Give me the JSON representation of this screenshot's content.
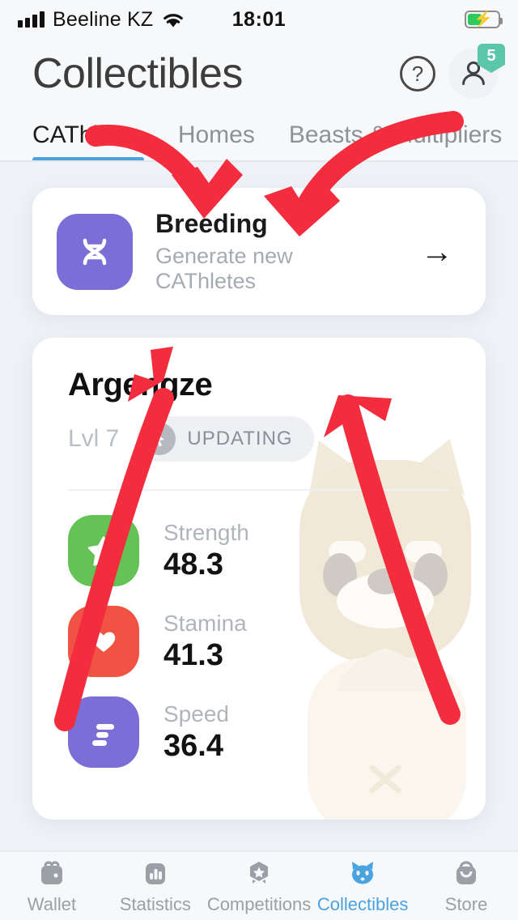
{
  "status_bar": {
    "carrier": "Beeline KZ",
    "time": "18:01",
    "signal_icon": "signal-bars-icon",
    "wifi_icon": "wifi-icon",
    "battery_icon": "battery-charging-icon"
  },
  "header": {
    "title": "Collectibles",
    "help_icon": "question-mark-icon",
    "help_label": "?",
    "profile_icon": "person-icon",
    "profile_badge": "5",
    "badge_color": "#5cc6aa"
  },
  "tabs": {
    "active_index": 0,
    "active_color": "#4aa3df",
    "items": [
      {
        "label": "CAThletes"
      },
      {
        "label": "Homes"
      },
      {
        "label": "Beasts & Multipliers"
      }
    ]
  },
  "breeding_card": {
    "icon": "dna-icon",
    "icon_color": "#7b6ed6",
    "title": "Breeding",
    "subtitle": "Generate new CAThletes",
    "arrow": "→",
    "arrow_icon": "arrow-right-icon"
  },
  "cat_card": {
    "name": "Argengze",
    "level": "Lvl 7",
    "status_badge": "UPDATING",
    "status_icon": "cursor-pointer-icon",
    "avatar_icon": "cat-avatar-illustration",
    "stats": [
      {
        "label": "Strength",
        "value": "48.3",
        "color": "#63c354",
        "icon": "star-icon"
      },
      {
        "label": "Stamina",
        "value": "41.3",
        "color": "#f05344",
        "icon": "heart-icon"
      },
      {
        "label": "Speed",
        "value": "36.4",
        "color": "#7b6ed6",
        "icon": "speed-lines-icon"
      }
    ]
  },
  "bottom_nav": {
    "active_index": 3,
    "active_color": "#4aa3df",
    "inactive_color": "#9aa0a6",
    "items": [
      {
        "label": "Wallet",
        "icon": "wallet-icon"
      },
      {
        "label": "Statistics",
        "icon": "bar-chart-icon"
      },
      {
        "label": "Competitions",
        "icon": "medal-star-icon"
      },
      {
        "label": "Collectibles",
        "icon": "cat-face-icon"
      },
      {
        "label": "Store",
        "icon": "shopping-bag-icon"
      }
    ]
  },
  "annotations": {
    "arrow_color": "#f32c3e",
    "count": 4
  }
}
